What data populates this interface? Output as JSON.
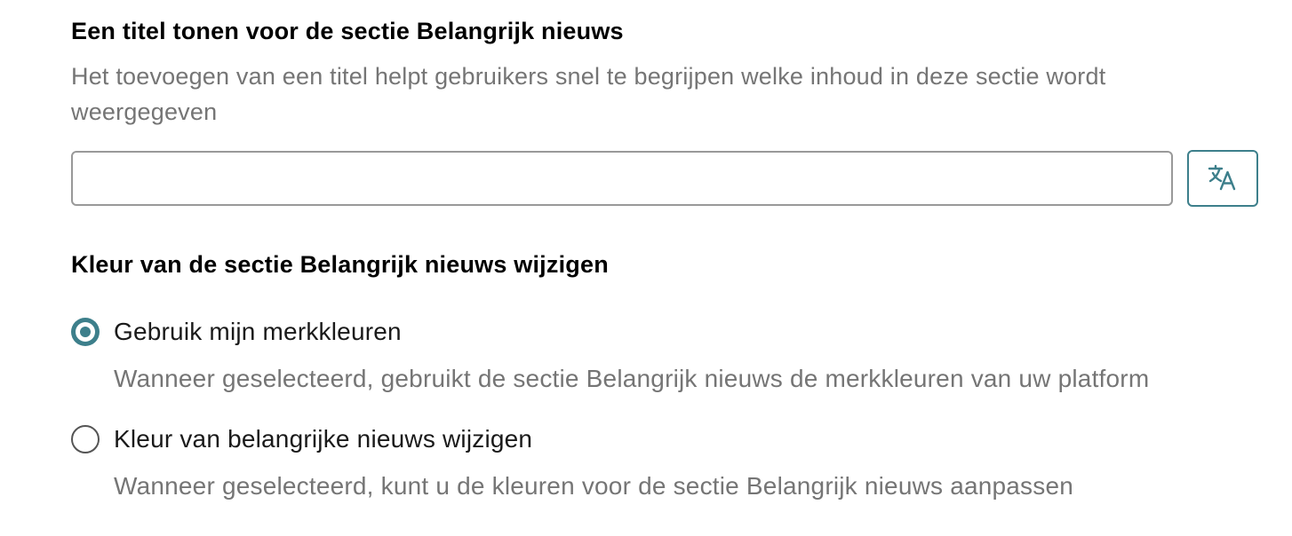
{
  "title_section": {
    "heading": "Een titel tonen voor de sectie Belangrijk nieuws",
    "description": "Het toevoegen van een titel helpt gebruikers snel te begrijpen welke inhoud in deze sectie wordt weergegeven",
    "input_value": "",
    "translate_icon": "translate-icon"
  },
  "color_section": {
    "heading": "Kleur van de sectie Belangrijk nieuws wijzigen",
    "options": [
      {
        "label": "Gebruik mijn merkkleuren",
        "help": "Wanneer geselecteerd, gebruikt de sectie Belangrijk nieuws de merkkleuren van uw platform",
        "selected": true
      },
      {
        "label": "Kleur van belangrijke nieuws wijzigen",
        "help": "Wanneer geselecteerd, kunt u de kleuren voor de sectie Belangrijk nieuws aanpassen",
        "selected": false
      }
    ]
  },
  "colors": {
    "accent": "#3d7f8b",
    "muted_text": "#757575",
    "input_border": "#999999"
  }
}
